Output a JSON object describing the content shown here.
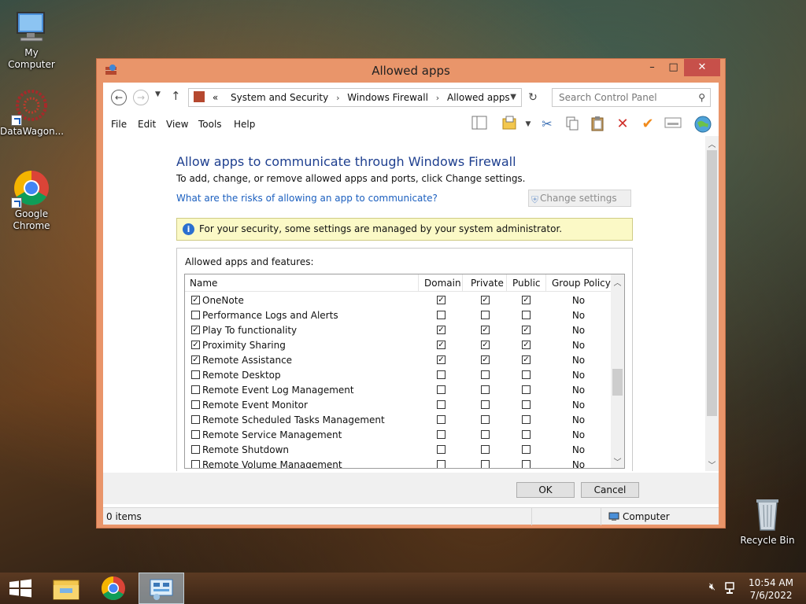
{
  "desktop": {
    "icons": [
      {
        "label": "My Computer"
      },
      {
        "label": "DataWagon..."
      },
      {
        "label": "Google Chrome"
      },
      {
        "label": "Recycle Bin"
      }
    ]
  },
  "window": {
    "title": "Allowed apps",
    "controls": {
      "minimize": "–",
      "maximize": "□",
      "close": "✕"
    }
  },
  "addressbar": {
    "prefix": "«",
    "breadcrumbs": [
      "System and Security",
      "Windows Firewall",
      "Allowed apps"
    ],
    "search_placeholder": "Search Control Panel"
  },
  "menu": {
    "items": [
      "File",
      "Edit",
      "View",
      "Tools",
      "Help"
    ]
  },
  "page": {
    "heading": "Allow apps to communicate through Windows Firewall",
    "subtext": "To add, change, or remove allowed apps and ports, click Change settings.",
    "risk_link": "What are the risks of allowing an app to communicate?",
    "change_settings": "Change settings",
    "info_message": "For your security, some settings are managed by your system administrator.",
    "group_title": "Allowed apps and features:"
  },
  "table": {
    "columns": [
      "Name",
      "Domain",
      "Private",
      "Public",
      "Group Policy"
    ],
    "rows": [
      {
        "name": "OneNote",
        "enabled": true,
        "domain": true,
        "private": true,
        "public": true,
        "gp": "No"
      },
      {
        "name": "Performance Logs and Alerts",
        "enabled": false,
        "domain": false,
        "private": false,
        "public": false,
        "gp": "No"
      },
      {
        "name": "Play To functionality",
        "enabled": true,
        "domain": true,
        "private": true,
        "public": true,
        "gp": "No"
      },
      {
        "name": "Proximity Sharing",
        "enabled": true,
        "domain": true,
        "private": true,
        "public": true,
        "gp": "No"
      },
      {
        "name": "Remote Assistance",
        "enabled": true,
        "domain": true,
        "private": true,
        "public": true,
        "gp": "No"
      },
      {
        "name": "Remote Desktop",
        "enabled": false,
        "domain": false,
        "private": false,
        "public": false,
        "gp": "No"
      },
      {
        "name": "Remote Event Log Management",
        "enabled": false,
        "domain": false,
        "private": false,
        "public": false,
        "gp": "No"
      },
      {
        "name": "Remote Event Monitor",
        "enabled": false,
        "domain": false,
        "private": false,
        "public": false,
        "gp": "No"
      },
      {
        "name": "Remote Scheduled Tasks Management",
        "enabled": false,
        "domain": false,
        "private": false,
        "public": false,
        "gp": "No"
      },
      {
        "name": "Remote Service Management",
        "enabled": false,
        "domain": false,
        "private": false,
        "public": false,
        "gp": "No"
      },
      {
        "name": "Remote Shutdown",
        "enabled": false,
        "domain": false,
        "private": false,
        "public": false,
        "gp": "No"
      },
      {
        "name": "Remote Volume Management",
        "enabled": false,
        "domain": false,
        "private": false,
        "public": false,
        "gp": "No"
      }
    ]
  },
  "buttons": {
    "ok": "OK",
    "cancel": "Cancel"
  },
  "status": {
    "items": "0 items",
    "location": "Computer"
  },
  "taskbar": {
    "clock_time": "10:54 AM",
    "clock_date": "7/6/2022"
  },
  "colors": {
    "window_frame": "#e9956a",
    "close_button": "#c7504a",
    "heading": "#1e3f8f",
    "link": "#1b5fbf",
    "info_bg": "#fbf9c6"
  }
}
